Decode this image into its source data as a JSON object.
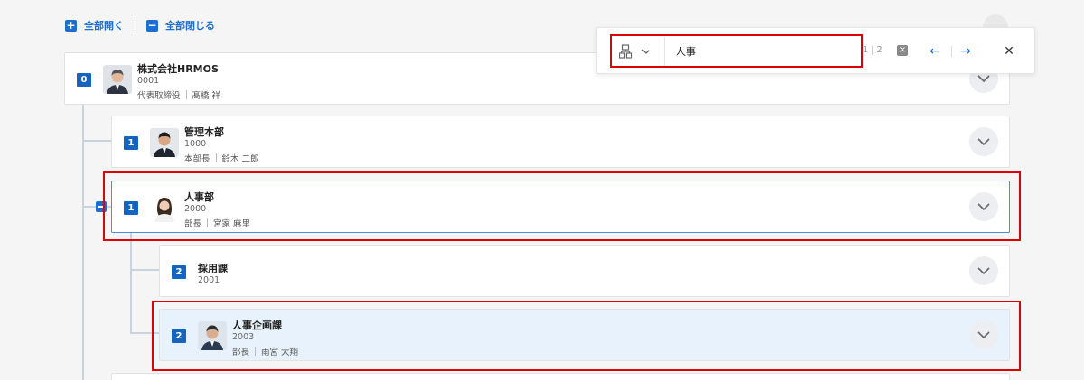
{
  "toolbar": {
    "expand_all": "全部開く",
    "collapse_all": "全部閉じる"
  },
  "search": {
    "query": "人事",
    "current": "1",
    "total": "2",
    "scope_icon": "org-chart-icon",
    "prev_icon": "arrow-left-icon",
    "next_icon": "arrow-right-icon",
    "close_icon": "close-icon"
  },
  "nodes": [
    {
      "level": "0",
      "name": "株式会社HRMOS",
      "code": "0001",
      "role": "代表取締役",
      "person": "髙橋 祥"
    },
    {
      "level": "1",
      "name": "管理本部",
      "code": "1000",
      "role": "本部長",
      "person": "鈴木 二郎"
    },
    {
      "level": "1",
      "name": "人事部",
      "code": "2000",
      "role": "部長",
      "person": "宮家 麻里"
    },
    {
      "level": "2",
      "name": "採用課",
      "code": "2001"
    },
    {
      "level": "2",
      "name": "人事企画課",
      "code": "2003",
      "role": "部長",
      "person": "雨宮 大翔"
    }
  ],
  "colors": {
    "accent": "#1a6fd1",
    "level_badge": "#1565c0",
    "highlight_row": "#e8f2fc",
    "search_match_outline": "#e00000"
  }
}
